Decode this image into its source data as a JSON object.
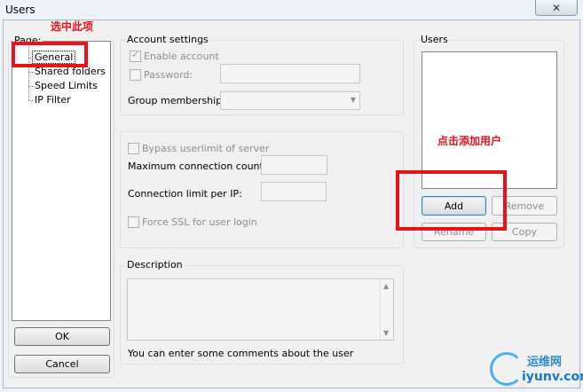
{
  "window": {
    "title": "Users",
    "close_glyph": "✕"
  },
  "page_tree": {
    "group_label": "Page:",
    "items": [
      "General",
      "Shared folders",
      "Speed Limits",
      "IP Filter"
    ]
  },
  "footer_buttons": {
    "ok": "OK",
    "cancel": "Cancel"
  },
  "account_settings": {
    "group_label": "Account settings",
    "enable_account": "Enable account",
    "password": "Password:",
    "group_membership": "Group membership:",
    "password_value": "",
    "group_membership_value": ""
  },
  "limits": {
    "bypass_userlimit": "Bypass userlimit of server",
    "max_connection_count": "Maximum connection count:",
    "connection_limit_per_ip": "Connection limit per IP:",
    "force_ssl": "Force SSL for user login",
    "max_connection_value": "",
    "connection_limit_value": ""
  },
  "description": {
    "group_label": "Description",
    "hint": "You can enter some comments about the user",
    "value": ""
  },
  "users": {
    "group_label": "Users",
    "items": [],
    "add": "Add",
    "remove": "Remove",
    "rename": "Rename",
    "copy": "Copy"
  },
  "annotations": {
    "select_this_item": "选中此项",
    "click_add_user": "点击添加用户"
  },
  "watermark": {
    "cn": "运维网",
    "en": "iyunv.com"
  },
  "colors": {
    "annotation_red": "#e8121b",
    "title_bar": "#eef3fa",
    "dialog_bg": "#f0f0f0"
  }
}
